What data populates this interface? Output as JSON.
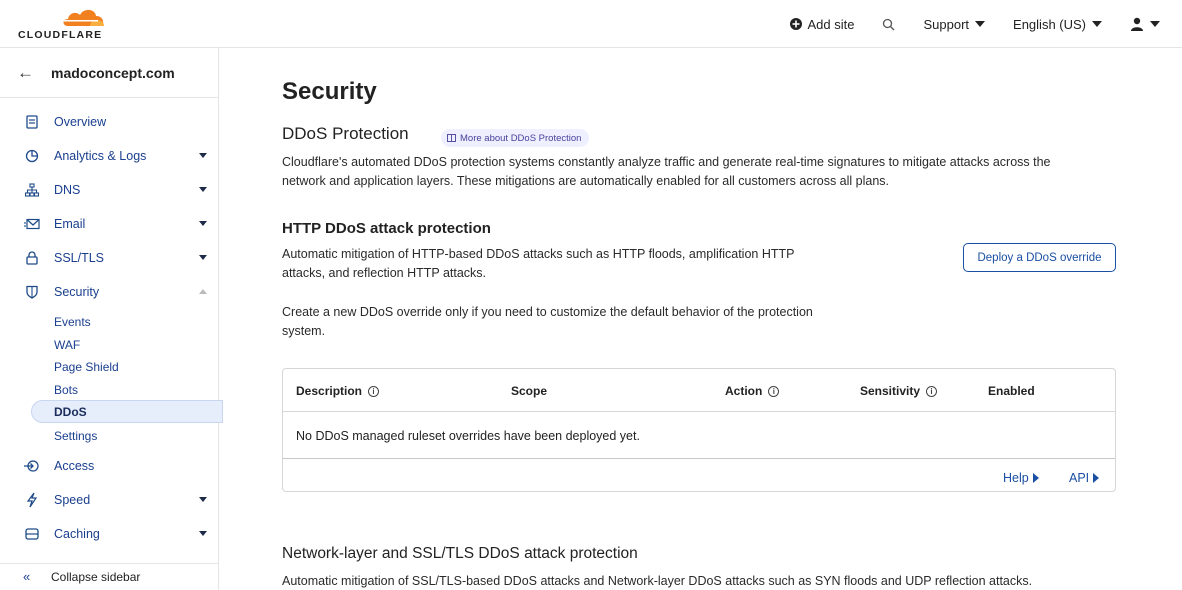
{
  "brand": {
    "logo_text": "CLOUDFLARE",
    "accent": "#f38020",
    "link_color": "#1a4fa3"
  },
  "topbar": {
    "add_site": "Add site",
    "support": "Support",
    "language": "English (US)"
  },
  "sidebar": {
    "site_name": "madoconcept.com",
    "items": [
      {
        "label": "Overview"
      },
      {
        "label": "Analytics & Logs"
      },
      {
        "label": "DNS"
      },
      {
        "label": "Email"
      },
      {
        "label": "SSL/TLS"
      },
      {
        "label": "Security"
      },
      {
        "label": "Access"
      },
      {
        "label": "Speed"
      },
      {
        "label": "Caching"
      }
    ],
    "security_sub": [
      "Events",
      "WAF",
      "Page Shield",
      "Bots",
      "DDoS",
      "Settings"
    ],
    "collapse_label": "Collapse sidebar"
  },
  "main": {
    "title": "Security",
    "section_title": "DDoS Protection",
    "more_pill": "More about DDoS Protection",
    "intro_line1": "Cloudflare's automated DDoS protection systems constantly analyze traffic and generate real-time signatures to mitigate attacks across the",
    "intro_line2": "network and application layers. These mitigations are automatically enabled for all customers across all plans.",
    "http_title": "HTTP DDoS attack protection",
    "http_desc_line1": "Automatic mitigation of HTTP-based DDoS attacks such as HTTP floods, amplification HTTP",
    "http_desc_line2": "attacks, and reflection HTTP attacks.",
    "deploy_button": "Deploy a DDoS override",
    "override_line1": "Create a new DDoS override only if you need to customize the default behavior of the protection",
    "override_line2": "system.",
    "table": {
      "columns": [
        "Description",
        "Scope",
        "Action",
        "Sensitivity",
        "Enabled"
      ],
      "empty_message": "No DDoS managed ruleset overrides have been deployed yet.",
      "help_link": "Help",
      "api_link": "API"
    },
    "network_title": "Network-layer and SSL/TLS DDoS attack protection",
    "network_desc": "Automatic mitigation of SSL/TLS-based DDoS attacks and Network-layer DDoS attacks such as SYN floods and UDP reflection attacks."
  }
}
